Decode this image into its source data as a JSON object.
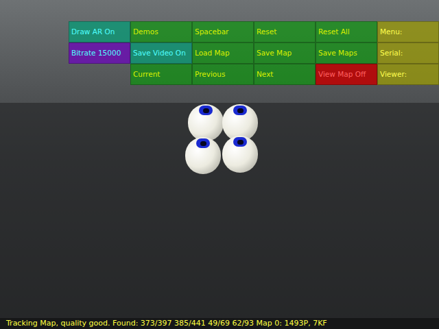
{
  "menu": {
    "rows": [
      [
        {
          "label": "Draw AR On",
          "kind": "on"
        },
        {
          "label": "Demos",
          "kind": "button"
        },
        {
          "label": "Spacebar",
          "kind": "button"
        },
        {
          "label": "Reset",
          "kind": "button"
        },
        {
          "label": "Reset All",
          "kind": "button"
        },
        {
          "label": "Menu:",
          "kind": "label"
        }
      ],
      [
        {
          "label": "Bitrate 15000",
          "kind": "setting"
        },
        {
          "label": "Save Video On",
          "kind": "on"
        },
        {
          "label": "Load Map",
          "kind": "button"
        },
        {
          "label": "Save Map",
          "kind": "button"
        },
        {
          "label": "Save Maps",
          "kind": "button"
        },
        {
          "label": "Serial:",
          "kind": "label"
        }
      ],
      [
        {
          "label": "",
          "kind": "empty"
        },
        {
          "label": "Current",
          "kind": "button"
        },
        {
          "label": "Previous",
          "kind": "button"
        },
        {
          "label": "Next",
          "kind": "button"
        },
        {
          "label": "View Map Off",
          "kind": "off"
        },
        {
          "label": "Viewer:",
          "kind": "label"
        }
      ]
    ]
  },
  "status_bar": "Tracking Map, quality good. Found: 373/397 385/441 49/69 62/93 Map 0: 1493P, 7KF"
}
